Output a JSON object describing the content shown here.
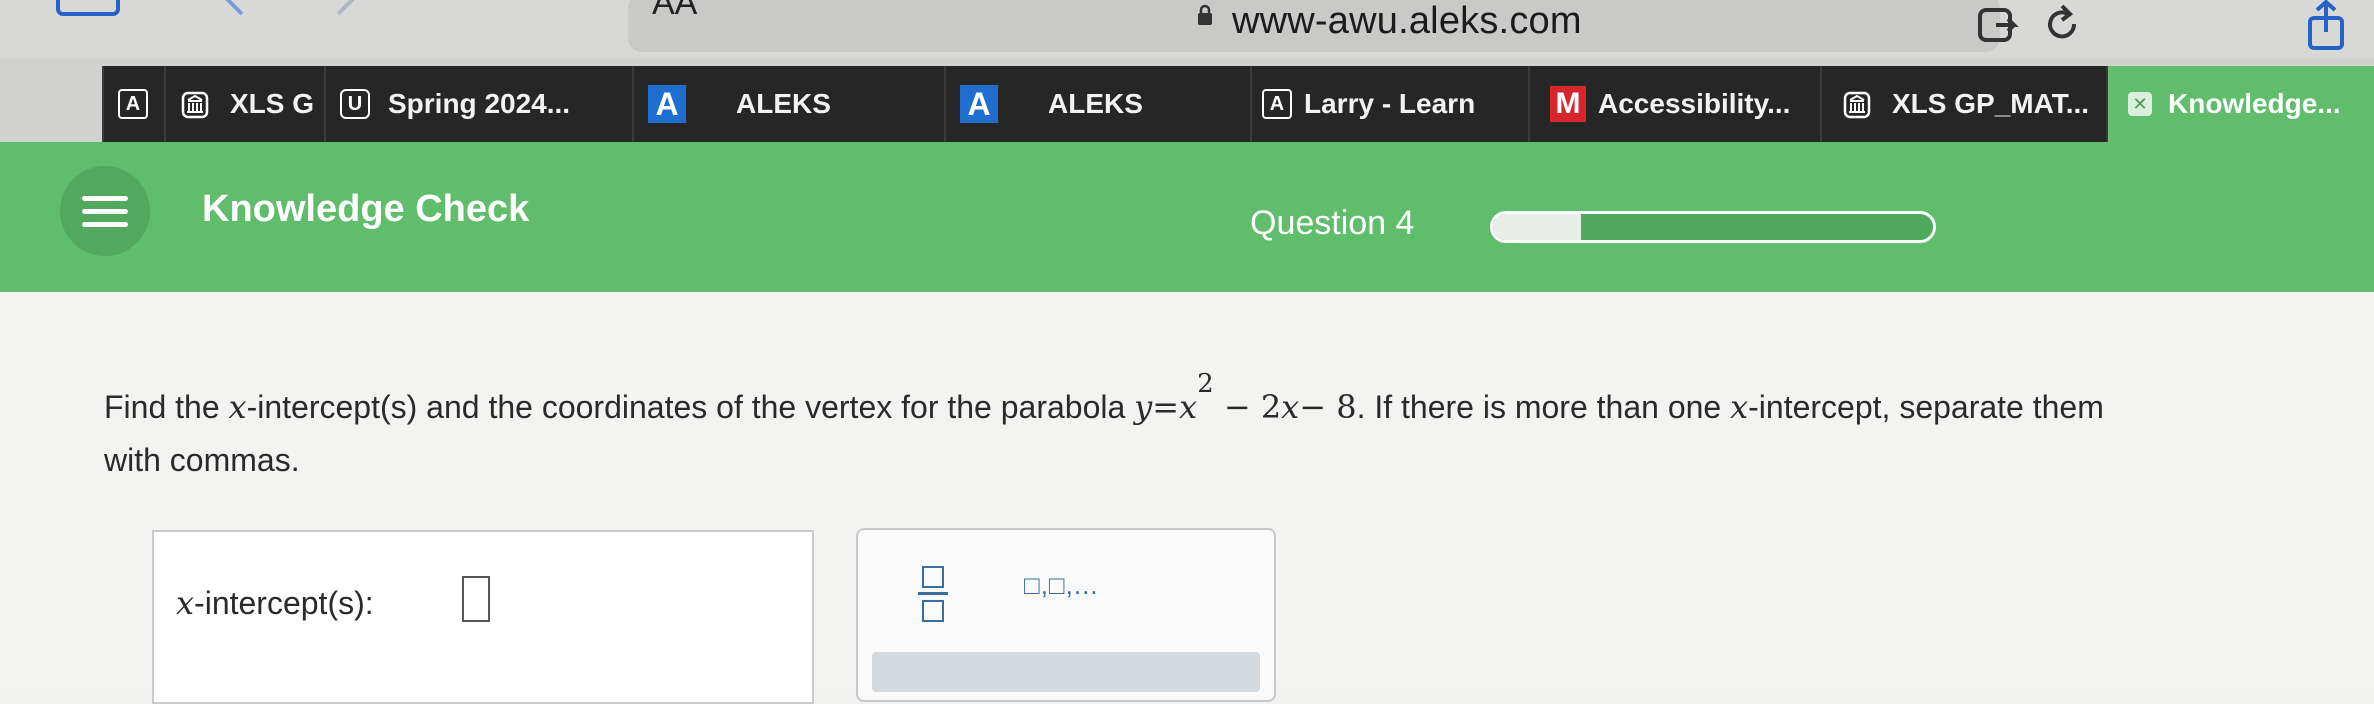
{
  "browser": {
    "text_size_button": "AA",
    "url": "www-awu.aleks.com",
    "icons": [
      "sidebar-icon",
      "back-icon",
      "forward-icon",
      "lock-icon",
      "extension-icon",
      "reload-icon",
      "share-icon"
    ]
  },
  "tabs": [
    {
      "icon": "a-box",
      "icon_text": "A",
      "label": ""
    },
    {
      "icon": "building",
      "icon_text": "",
      "label": "XLS G"
    },
    {
      "icon": "u-box",
      "icon_text": "U",
      "label": "Spring 2024..."
    },
    {
      "icon": "a-blue",
      "icon_text": "A",
      "label": "ALEKS"
    },
    {
      "icon": "a-blue",
      "icon_text": "A",
      "label": "ALEKS"
    },
    {
      "icon": "a-box",
      "icon_text": "A",
      "label": "Larry - Learn"
    },
    {
      "icon": "m-red",
      "icon_text": "M",
      "label": "Accessibility..."
    },
    {
      "icon": "building",
      "icon_text": "",
      "label": "XLS GP_MAT..."
    },
    {
      "icon": "x-box",
      "icon_text": "✕",
      "label": "Knowledge..."
    }
  ],
  "header": {
    "title": "Knowledge Check",
    "question_label": "Question 4",
    "progress_fraction": 0.2,
    "color": "#5fbd6b"
  },
  "question": {
    "p1": "Find the ",
    "x1": "x",
    "p2": "-intercept(s) and the coordinates of the vertex for the parabola ",
    "eq_y": "y",
    "eq_eq": "=",
    "eq_x": "x",
    "eq_exp": "2",
    "eq_rest1": " − 2",
    "eq_x2": "x",
    "eq_rest2": "− 8",
    "p3": ". If there is more than one ",
    "x2": "x",
    "p4": "-intercept, separate them",
    "p5": "with commas."
  },
  "answer": {
    "x_var": "x",
    "label_rest": "-intercept(s):",
    "value": ""
  },
  "keypad": {
    "list_button": "□,□,..."
  }
}
